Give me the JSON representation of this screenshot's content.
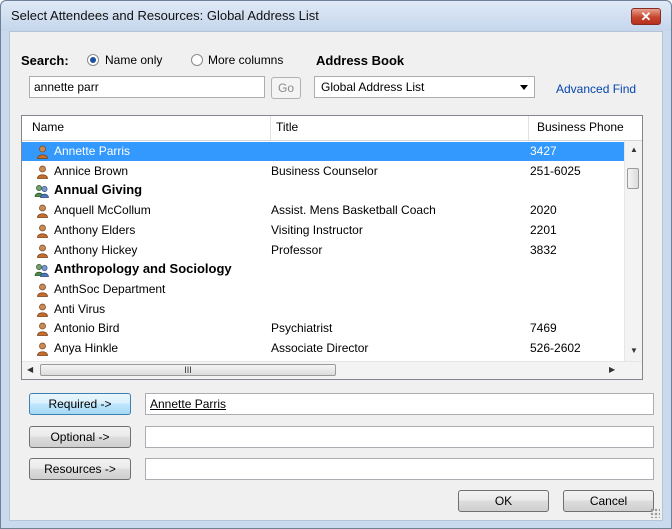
{
  "window": {
    "title": "Select Attendees and Resources: Global Address List",
    "close_glyph": "✕"
  },
  "search": {
    "label": "Search:",
    "option_name_only": "Name only",
    "option_more_columns": "More columns",
    "selected_option": "Name only",
    "query": "annette parr",
    "go_label": "Go"
  },
  "address_book": {
    "label": "Address Book",
    "selected": "Global Address List",
    "advanced_find_label": "Advanced Find"
  },
  "list": {
    "columns": [
      "Name",
      "Title",
      "Business Phone"
    ],
    "rows": [
      {
        "name": "Annette Parris",
        "title": "",
        "phone": "3427",
        "type": "person",
        "selected": true
      },
      {
        "name": "Annice Brown",
        "title": "Business Counselor",
        "phone": "251-6025",
        "type": "person",
        "selected": false
      },
      {
        "name": "Annual Giving",
        "title": "",
        "phone": "",
        "type": "group",
        "selected": false
      },
      {
        "name": "Anquell McCollum",
        "title": "Assist. Mens Basketball Coach",
        "phone": "2020",
        "type": "person",
        "selected": false
      },
      {
        "name": "Anthony Elders",
        "title": "Visiting Instructor",
        "phone": "2201",
        "type": "person",
        "selected": false
      },
      {
        "name": "Anthony Hickey",
        "title": "Professor",
        "phone": "3832",
        "type": "person",
        "selected": false
      },
      {
        "name": "Anthropology and Sociology",
        "title": "",
        "phone": "",
        "type": "group",
        "selected": false
      },
      {
        "name": "AnthSoc Department",
        "title": "",
        "phone": "",
        "type": "person",
        "selected": false
      },
      {
        "name": "Anti Virus",
        "title": "",
        "phone": "",
        "type": "person",
        "selected": false
      },
      {
        "name": "Antonio Bird",
        "title": "Psychiatrist",
        "phone": "7469",
        "type": "person",
        "selected": false
      },
      {
        "name": "Anya Hinkle",
        "title": "Associate Director",
        "phone": "526-2602",
        "type": "person",
        "selected": false
      }
    ],
    "hscroll_glyph": "III"
  },
  "recipients": {
    "required_label": "Required ->",
    "required_value": "Annette Parris",
    "optional_label": "Optional ->",
    "optional_value": "",
    "resources_label": "Resources ->",
    "resources_value": ""
  },
  "footer": {
    "ok_label": "OK",
    "cancel_label": "Cancel"
  },
  "colors": {
    "selection": "#3399ff",
    "link": "#0645ad",
    "titlebar": "#c5d6ec",
    "close": "#c7452e"
  },
  "icons": [
    "close-icon",
    "person-icon",
    "group-icon",
    "dropdown-arrow-icon",
    "scroll-arrow-icons",
    "resize-grip-icon"
  ]
}
